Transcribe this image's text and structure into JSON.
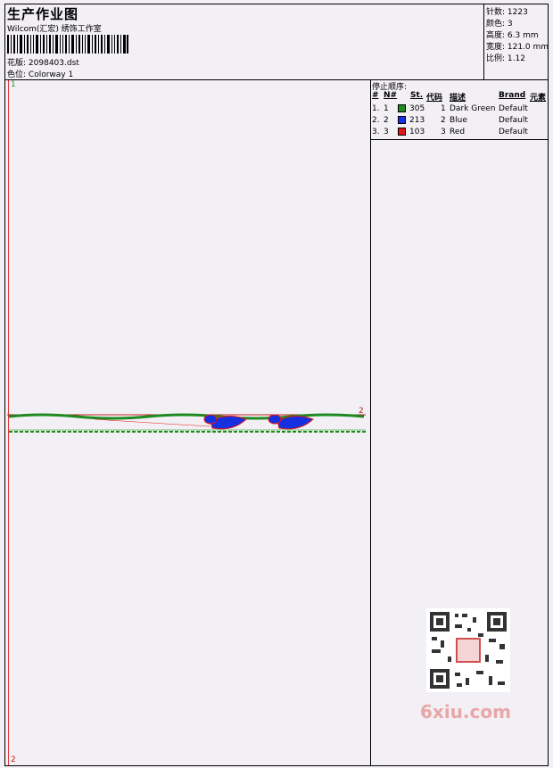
{
  "header": {
    "title": "生产作业图",
    "studio": "Wilcom(汇宏) 绣饰工作室",
    "design_label": "花版:",
    "design_value": "2098403.dst",
    "colorway_label": "色位:",
    "colorway_value": "Colorway 1"
  },
  "stats": {
    "stitches": "针数: 1223",
    "colors": "颜色: 3",
    "height": "高度: 6.3 mm",
    "width": "宽度: 121.0 mm",
    "scale": "比例: 1.12"
  },
  "design": {
    "marker_start": "1",
    "marker_end": "2",
    "marker_side": "2"
  },
  "stop_sequence": {
    "title": "停止顺序:",
    "columns": [
      "#",
      "N#",
      "St.",
      "代码",
      "描述",
      "Brand",
      "元素"
    ],
    "rows": [
      {
        "idx": "1.",
        "n": "1",
        "st": "305",
        "code": "1",
        "desc": "Dark Green",
        "brand": "Default",
        "swatch": "#1f8a1f"
      },
      {
        "idx": "2.",
        "n": "2",
        "st": "213",
        "code": "2",
        "desc": "Blue",
        "brand": "Default",
        "swatch": "#1630e0"
      },
      {
        "idx": "3.",
        "n": "3",
        "st": "103",
        "code": "3",
        "desc": "Red",
        "brand": "Default",
        "swatch": "#e01818"
      }
    ]
  },
  "watermark": {
    "text": "6xiu.com"
  }
}
